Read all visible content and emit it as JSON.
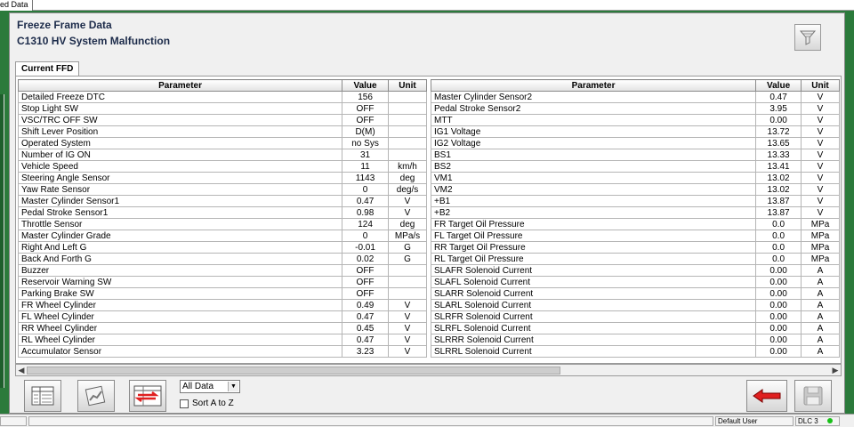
{
  "window": {
    "top_tab_label": "ed Data"
  },
  "header": {
    "title": "Freeze Frame Data",
    "subtitle": "C1310 HV System Malfunction"
  },
  "tabs": [
    {
      "label": "Current FFD"
    }
  ],
  "table": {
    "columns": {
      "parameter": "Parameter",
      "value": "Value",
      "unit": "Unit"
    },
    "left_rows": [
      {
        "parameter": "Detailed Freeze DTC",
        "value": "156",
        "unit": ""
      },
      {
        "parameter": "Stop Light SW",
        "value": "OFF",
        "unit": ""
      },
      {
        "parameter": "VSC/TRC OFF SW",
        "value": "OFF",
        "unit": ""
      },
      {
        "parameter": "Shift Lever Position",
        "value": "D(M)",
        "unit": ""
      },
      {
        "parameter": "Operated System",
        "value": "no Sys",
        "unit": ""
      },
      {
        "parameter": "Number of IG ON",
        "value": "31",
        "unit": ""
      },
      {
        "parameter": "Vehicle Speed",
        "value": "11",
        "unit": "km/h"
      },
      {
        "parameter": "Steering Angle Sensor",
        "value": "1143",
        "unit": "deg"
      },
      {
        "parameter": "Yaw Rate Sensor",
        "value": "0",
        "unit": "deg/s"
      },
      {
        "parameter": "Master Cylinder Sensor1",
        "value": "0.47",
        "unit": "V"
      },
      {
        "parameter": "Pedal Stroke Sensor1",
        "value": "0.98",
        "unit": "V"
      },
      {
        "parameter": "Throttle Sensor",
        "value": "124",
        "unit": "deg"
      },
      {
        "parameter": "Master Cylinder Grade",
        "value": "0",
        "unit": "MPa/s"
      },
      {
        "parameter": "Right And Left G",
        "value": "-0.01",
        "unit": "G"
      },
      {
        "parameter": "Back And Forth G",
        "value": "0.02",
        "unit": "G"
      },
      {
        "parameter": "Buzzer",
        "value": "OFF",
        "unit": ""
      },
      {
        "parameter": "Reservoir Warning SW",
        "value": "OFF",
        "unit": ""
      },
      {
        "parameter": "Parking Brake SW",
        "value": "OFF",
        "unit": ""
      },
      {
        "parameter": "FR Wheel Cylinder",
        "value": "0.49",
        "unit": "V"
      },
      {
        "parameter": "FL Wheel Cylinder",
        "value": "0.47",
        "unit": "V"
      },
      {
        "parameter": "RR Wheel Cylinder",
        "value": "0.45",
        "unit": "V"
      },
      {
        "parameter": "RL Wheel Cylinder",
        "value": "0.47",
        "unit": "V"
      },
      {
        "parameter": "Accumulator Sensor",
        "value": "3.23",
        "unit": "V"
      }
    ],
    "right_rows": [
      {
        "parameter": "Master Cylinder Sensor2",
        "value": "0.47",
        "unit": "V"
      },
      {
        "parameter": "Pedal Stroke Sensor2",
        "value": "3.95",
        "unit": "V"
      },
      {
        "parameter": "MTT",
        "value": "0.00",
        "unit": "V"
      },
      {
        "parameter": "IG1 Voltage",
        "value": "13.72",
        "unit": "V"
      },
      {
        "parameter": "IG2 Voltage",
        "value": "13.65",
        "unit": "V"
      },
      {
        "parameter": "BS1",
        "value": "13.33",
        "unit": "V"
      },
      {
        "parameter": "BS2",
        "value": "13.41",
        "unit": "V"
      },
      {
        "parameter": "VM1",
        "value": "13.02",
        "unit": "V"
      },
      {
        "parameter": "VM2",
        "value": "13.02",
        "unit": "V"
      },
      {
        "parameter": "+B1",
        "value": "13.87",
        "unit": "V"
      },
      {
        "parameter": "+B2",
        "value": "13.87",
        "unit": "V"
      },
      {
        "parameter": "FR Target Oil Pressure",
        "value": "0.0",
        "unit": "MPa"
      },
      {
        "parameter": "FL Target Oil Pressure",
        "value": "0.0",
        "unit": "MPa"
      },
      {
        "parameter": "RR Target Oil Pressure",
        "value": "0.0",
        "unit": "MPa"
      },
      {
        "parameter": "RL Target Oil Pressure",
        "value": "0.0",
        "unit": "MPa"
      },
      {
        "parameter": "SLAFR Solenoid Current",
        "value": "0.00",
        "unit": "A"
      },
      {
        "parameter": "SLAFL Solenoid Current",
        "value": "0.00",
        "unit": "A"
      },
      {
        "parameter": "SLARR Solenoid Current",
        "value": "0.00",
        "unit": "A"
      },
      {
        "parameter": "SLARL Solenoid Current",
        "value": "0.00",
        "unit": "A"
      },
      {
        "parameter": "SLRFR Solenoid Current",
        "value": "0.00",
        "unit": "A"
      },
      {
        "parameter": "SLRFL Solenoid Current",
        "value": "0.00",
        "unit": "A"
      },
      {
        "parameter": "SLRRR Solenoid Current",
        "value": "0.00",
        "unit": "A"
      },
      {
        "parameter": "SLRRL Solenoid Current",
        "value": "0.00",
        "unit": "A"
      }
    ]
  },
  "toolbar": {
    "data_filter": {
      "selected": "All Data"
    },
    "sort_label": "Sort A to Z",
    "sort_checked": false
  },
  "statusbar": {
    "user": "Default User",
    "connection": "DLC 3",
    "led_color": "#18c018"
  },
  "icons": {
    "filter": "filter-funnel-icon",
    "back": "back-arrow-icon",
    "save": "save-disk-icon"
  }
}
